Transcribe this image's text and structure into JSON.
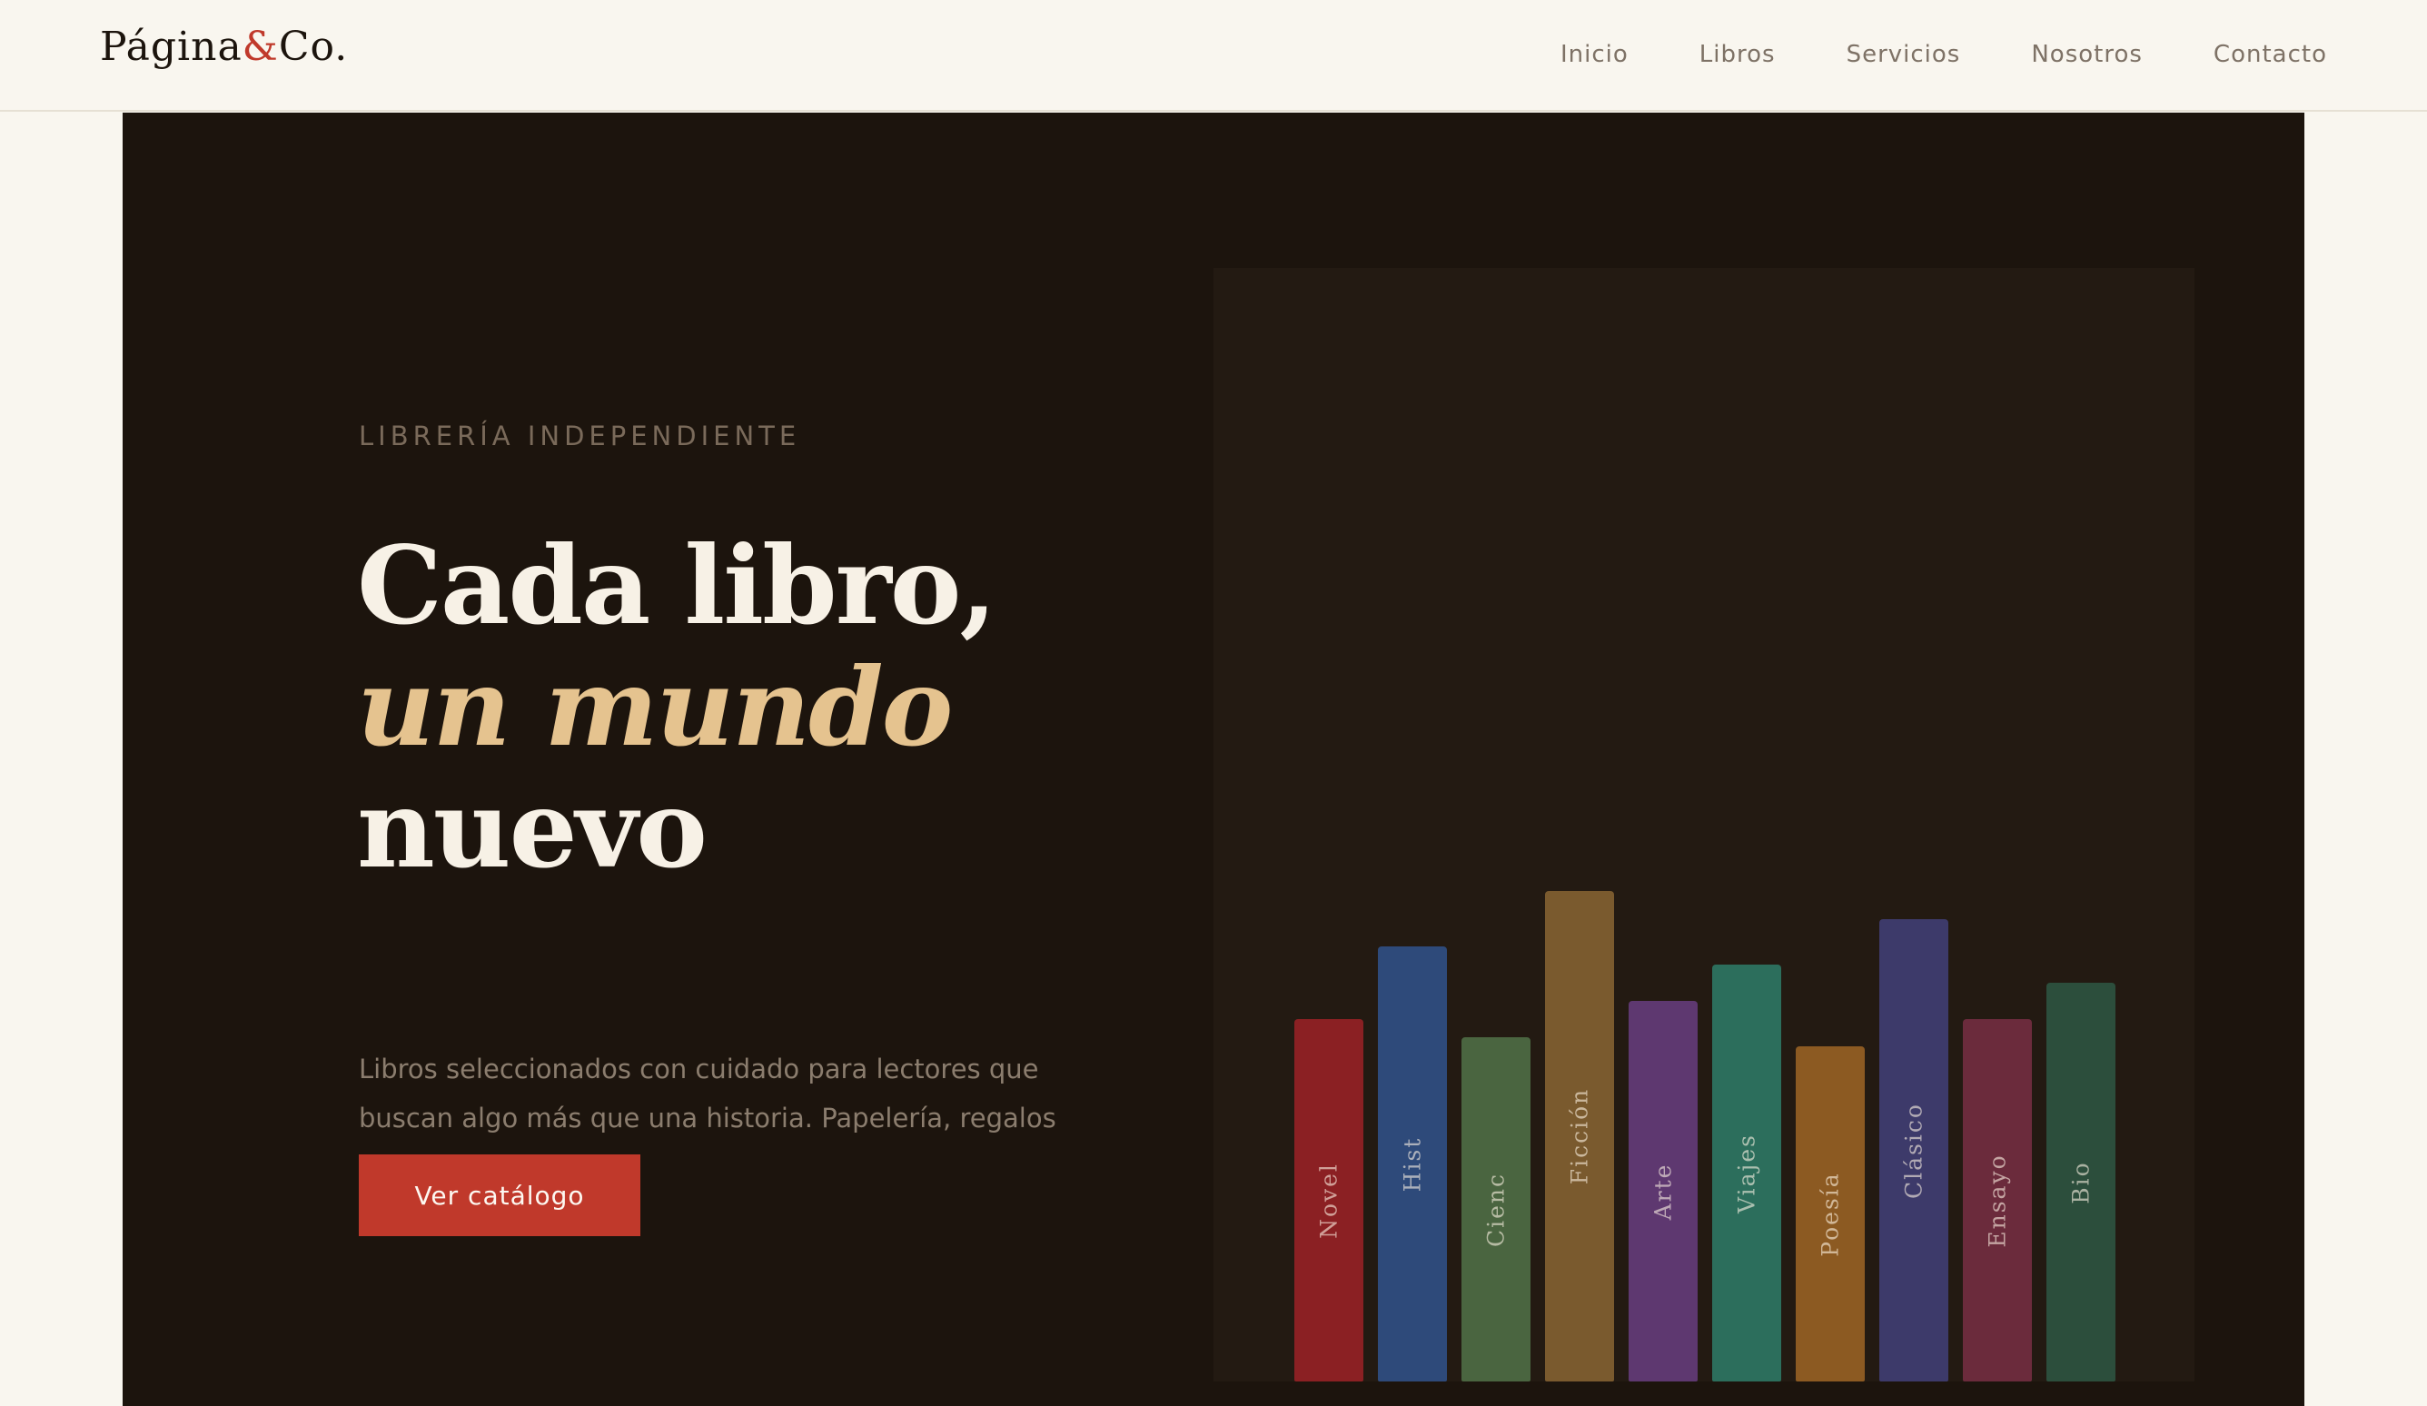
{
  "brand": {
    "name_part1": "Página",
    "ampersand": "&",
    "name_part2": "Co.",
    "accent_color": "#c0392b"
  },
  "nav": {
    "links": [
      {
        "label": "Inicio"
      },
      {
        "label": "Libros"
      },
      {
        "label": "Servicios"
      },
      {
        "label": "Nosotros"
      },
      {
        "label": "Contacto"
      }
    ]
  },
  "hero": {
    "eyebrow": "LIBRERÍA INDEPENDIENTE",
    "headline_line1": "Cada libro,",
    "headline_line2": "un mundo",
    "headline_line3": "nuevo",
    "lead": "Libros seleccionados con cuidado para lectores que buscan algo más que una historia. Papelería, regalos y mucho más.",
    "cta_label": "Ver catálogo",
    "background_color": "#1c140d",
    "accent_text_color": "#e5c38f"
  },
  "books": [
    {
      "label": "Novel",
      "color": "#8b2023"
    },
    {
      "label": "Hist",
      "color": "#2e4a7a"
    },
    {
      "label": "Cienc",
      "color": "#4a6540"
    },
    {
      "label": "Ficción",
      "color": "#7a5a2e"
    },
    {
      "label": "Arte",
      "color": "#5e3870"
    },
    {
      "label": "Viajes",
      "color": "#2c6e5c"
    },
    {
      "label": "Poesía",
      "color": "#8c5a22"
    },
    {
      "label": "Clásico",
      "color": "#3d3a6a"
    },
    {
      "label": "Ensayo",
      "color": "#6b2b3c"
    },
    {
      "label": "Bio",
      "color": "#2c4e3c"
    }
  ]
}
